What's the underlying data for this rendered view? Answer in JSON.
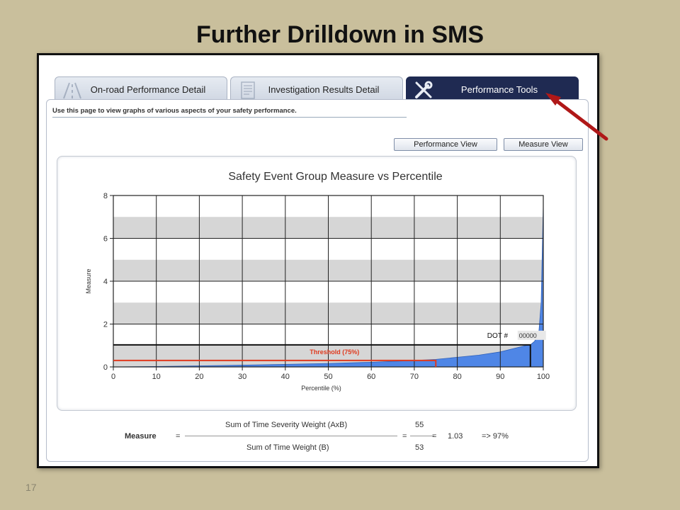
{
  "slide": {
    "title": "Further Drilldown in SMS",
    "page_number": "17"
  },
  "tabs": [
    {
      "label": "On-road Performance Detail",
      "icon": "road-icon",
      "active": false
    },
    {
      "label": "Investigation Results Detail",
      "icon": "document-icon",
      "active": false
    },
    {
      "label": "Performance Tools",
      "icon": "tools-icon",
      "active": true
    }
  ],
  "page": {
    "description": "Use this page to view graphs of various aspects of your safety performance."
  },
  "buttons": {
    "performance_view": "Performance View",
    "measure_view": "Measure View"
  },
  "chart_data": {
    "type": "area",
    "title": "Safety Event Group Measure vs Percentile",
    "xlabel": "Percentile (%)",
    "ylabel": "Measure",
    "xlim": [
      0,
      100
    ],
    "ylim": [
      0,
      8
    ],
    "x_ticks": [
      "0",
      "10",
      "20",
      "30",
      "40",
      "50",
      "60",
      "70",
      "80",
      "90",
      "100"
    ],
    "y_ticks": [
      "0",
      "2",
      "4",
      "6",
      "8"
    ],
    "grid": true,
    "shaded_bands": [
      [
        0,
        1
      ],
      [
        2,
        3
      ],
      [
        4,
        5
      ],
      [
        6,
        7
      ]
    ],
    "series": [
      {
        "x": [
          0,
          10,
          20,
          30,
          40,
          50,
          60,
          70,
          75,
          80,
          85,
          90,
          94,
          96,
          97,
          98,
          99,
          99.5,
          100
        ],
        "y": [
          0,
          0.02,
          0.05,
          0.08,
          0.12,
          0.16,
          0.22,
          0.3,
          0.35,
          0.45,
          0.55,
          0.7,
          0.9,
          1.0,
          1.03,
          1.2,
          1.7,
          3.0,
          7.6
        ],
        "color": "#4f86e6"
      }
    ],
    "threshold": {
      "label": "Threshold (75%)",
      "percentile": 75,
      "measure": 0.3,
      "color": "#e03a1e"
    },
    "carrier_marker": {
      "label": "DOT #",
      "value": "00000",
      "percentile": 97,
      "measure": 1.03
    }
  },
  "formula": {
    "label": "Measure",
    "eq": "=",
    "numerator_label": "Sum of Time Severity Weight (AxB)",
    "denominator_label": "Sum of Time Weight (B)",
    "numerator_value": "55",
    "denominator_value": "53",
    "result": "1.03",
    "percentile_result": "=> 97%"
  },
  "colors": {
    "active_tab": "#1f2a52",
    "annotation_arrow": "#b01818",
    "background": "#c9bf9c"
  }
}
